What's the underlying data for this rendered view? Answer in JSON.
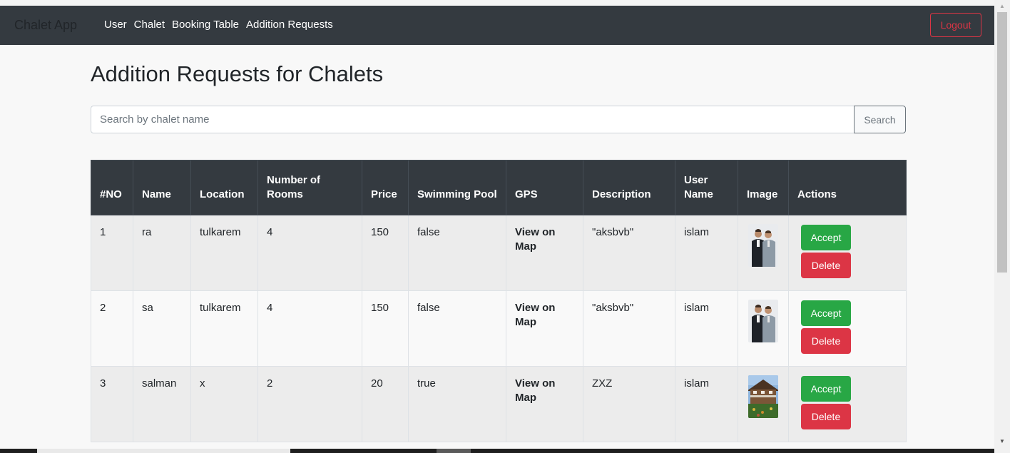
{
  "navbar": {
    "brand": "Chalet App",
    "links": [
      "User",
      "Chalet",
      "Booking Table",
      "Addition Requests"
    ],
    "logout_label": "Logout"
  },
  "page": {
    "title": "Addition Requests for Chalets"
  },
  "search": {
    "placeholder": "Search by chalet name",
    "value": "",
    "button_label": "Search"
  },
  "table": {
    "headers": [
      "#NO",
      "Name",
      "Location",
      "Number of Rooms",
      "Price",
      "Swimming Pool",
      "GPS",
      "Description",
      "User Name",
      "Image",
      "Actions"
    ],
    "rows": [
      {
        "no": "1",
        "name": "ra",
        "location": "tulkarem",
        "rooms": "4",
        "price": "150",
        "pool": "false",
        "gps": "View on Map",
        "description": "\"aksbvb\"",
        "user": "islam",
        "image": "two-men-photo",
        "accept": "Accept",
        "delete": "Delete"
      },
      {
        "no": "2",
        "name": "sa",
        "location": "tulkarem",
        "rooms": "4",
        "price": "150",
        "pool": "false",
        "gps": "View on Map",
        "description": "\"aksbvb\"",
        "user": "islam",
        "image": "two-men-photo",
        "accept": "Accept",
        "delete": "Delete"
      },
      {
        "no": "3",
        "name": "salman",
        "location": "x",
        "rooms": "2",
        "price": "20",
        "pool": "true",
        "gps": "View on Map",
        "description": "ZXZ",
        "user": "islam",
        "image": "chalet-photo",
        "accept": "Accept",
        "delete": "Delete"
      }
    ]
  },
  "colors": {
    "navbar_bg": "#343a40",
    "accept": "#28a745",
    "delete": "#dc3545"
  }
}
